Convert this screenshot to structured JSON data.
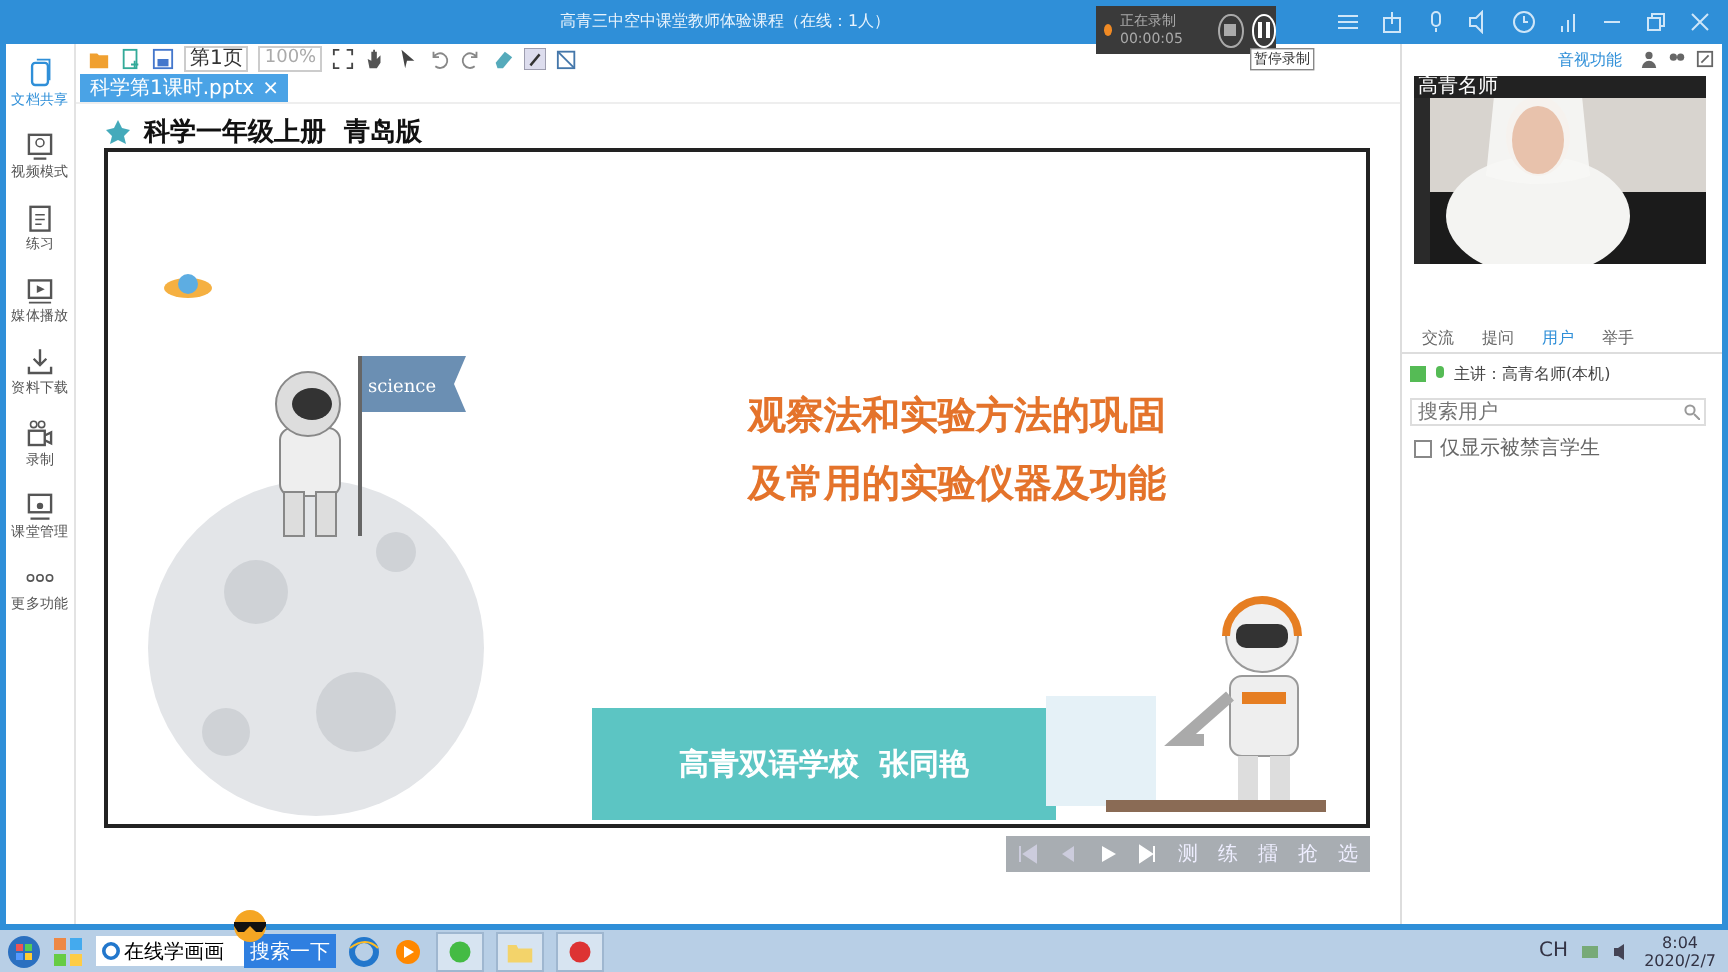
{
  "window": {
    "title": "高青三中空中课堂教师体验课程（在线：1人）"
  },
  "recording": {
    "status": "正在录制",
    "time": "00:00:05",
    "tooltip": "暂停录制"
  },
  "sidebar": {
    "items": [
      {
        "label": "文档共享",
        "selected": true
      },
      {
        "label": "视频模式",
        "selected": false
      },
      {
        "label": "练习",
        "selected": false
      },
      {
        "label": "媒体播放",
        "selected": false
      },
      {
        "label": "资料下载",
        "selected": false
      },
      {
        "label": "录制",
        "selected": false
      },
      {
        "label": "课堂管理",
        "selected": false
      },
      {
        "label": "更多功能",
        "selected": false
      }
    ]
  },
  "toolbar": {
    "page": "第1页",
    "zoom": "100%"
  },
  "doc_tabs": [
    {
      "label": "科学第1课时.pptx",
      "close": "×",
      "selected": true
    }
  ],
  "slide": {
    "heading": "科学一年级上册  青岛版",
    "flag_text": "science",
    "title_lines": [
      "观察法和实验方法的巩固",
      "及常用的实验仪器及功能"
    ],
    "banner": "高青双语学校  张同艳"
  },
  "player": {
    "buttons": [
      "测",
      "练",
      "擂",
      "抢",
      "选"
    ]
  },
  "right_panel": {
    "link": "音视功能",
    "video_label": "高青名师",
    "tabs": [
      {
        "label": "交流",
        "selected": false
      },
      {
        "label": "提问",
        "selected": false
      },
      {
        "label": "用户",
        "selected": true
      },
      {
        "label": "举手",
        "selected": false
      }
    ],
    "user": "主讲：高青名师(本机)",
    "search": {
      "placeholder": "搜索用户"
    },
    "filter": {
      "label": "仅显示被禁言学生",
      "checked": false
    }
  },
  "taskbar": {
    "search": {
      "value": "在线学画画"
    },
    "search_button": "搜索一下",
    "lang": "CH",
    "time": "8:04",
    "date": "2020/2/7"
  }
}
